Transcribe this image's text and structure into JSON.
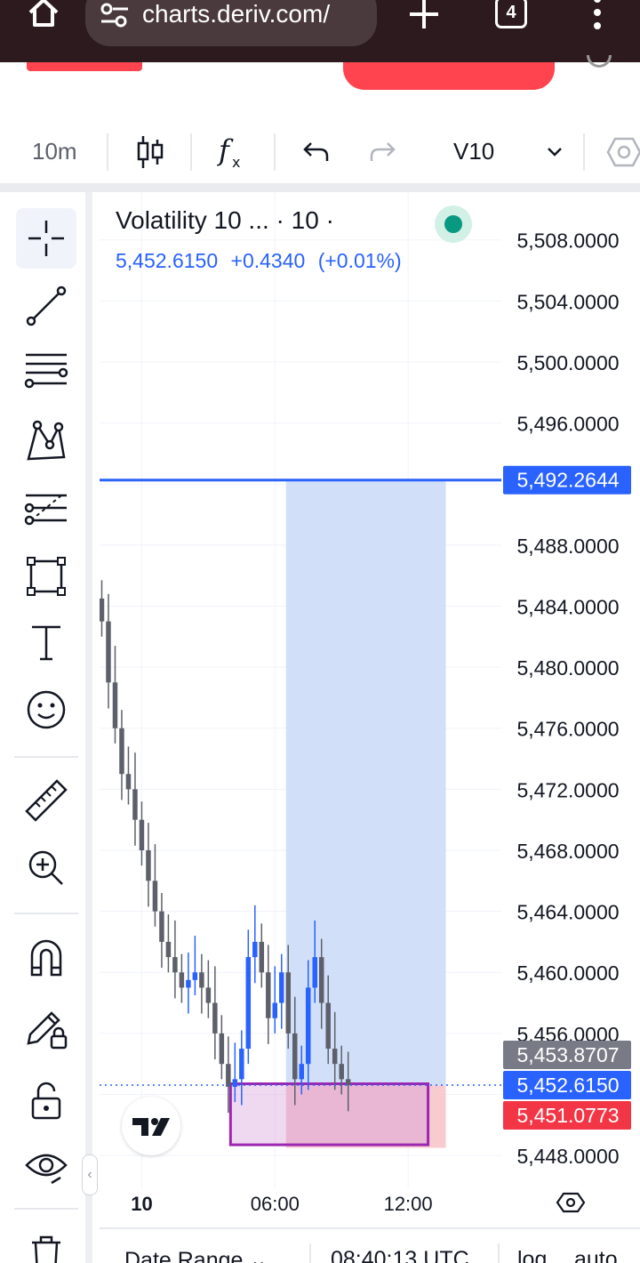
{
  "browser": {
    "url": "charts.deriv.com/",
    "tab_count": "4"
  },
  "toolbar": {
    "interval": "10m",
    "symbol_short": "V10"
  },
  "legend": {
    "title": "Volatility 10 ... · 10 ·",
    "last": "5,452.6150",
    "change": "+0.4340",
    "change_pct": "(+0.01%)"
  },
  "colors": {
    "accent": "#2962ff",
    "up": "#2962ff",
    "down": "#5d606b",
    "profit_zone": "#c9dbf7",
    "loss_zone": "#f7c5cc",
    "highlight_box": "#9c27b0",
    "stop_label": "#f23645",
    "target_label": "#2962ff",
    "entry_label": "#787b86",
    "live_dot": "#089981"
  },
  "bottom": {
    "date_range": "Date Range ⌄",
    "utc_time": "08:40:13 UTC",
    "scale_log": "log",
    "scale_auto": "auto"
  },
  "chart_data": {
    "type": "candlestick",
    "ylim": [
      5446.2,
      5510.2
    ],
    "y_ticks": [
      "5,508.0000",
      "5,504.0000",
      "5,500.0000",
      "5,496.0000",
      "5,488.0000",
      "5,484.0000",
      "5,480.0000",
      "5,476.0000",
      "5,472.0000",
      "5,468.0000",
      "5,464.0000",
      "5,460.0000",
      "5,456.0000",
      "5,448.0000"
    ],
    "y_tick_values": [
      5508,
      5504,
      5500,
      5496,
      5488,
      5484,
      5480,
      5476,
      5472,
      5468,
      5464,
      5460,
      5456,
      5448
    ],
    "x_ticks": [
      "10",
      "06:00",
      "12:00"
    ],
    "x_tick_hours": [
      0,
      6,
      12
    ],
    "xlim_hours": [
      -1.9,
      16.2
    ],
    "horizontal_line": {
      "value": 5492.2644,
      "label": "5,492.2644"
    },
    "price_labels": [
      {
        "kind": "target",
        "value": 5453.8707,
        "label": "5,453.8707"
      },
      {
        "kind": "last",
        "value": 5452.615,
        "label": "5,452.6150"
      },
      {
        "kind": "stop",
        "value": 5451.0773,
        "label": "5,451.0773"
      }
    ],
    "position_tool": {
      "start_hour": 6.5,
      "end_hour": 13.7,
      "target": 5492.2644,
      "entry": 5452.6,
      "stop": 5448.5
    },
    "highlight_box": {
      "start_hour": 4.0,
      "end_hour": 12.9,
      "top": 5452.7,
      "bottom": 5448.7
    },
    "candles": [
      {
        "t": -1.8,
        "c": 5483.0
      },
      {
        "t": -1.5,
        "c": 5479.0
      },
      {
        "t": -1.2,
        "c": 5476.0
      },
      {
        "t": -0.9,
        "c": 5473.0
      },
      {
        "t": -0.6,
        "c": 5472.0
      },
      {
        "t": -0.3,
        "c": 5470.0
      },
      {
        "t": 0.0,
        "c": 5468.0
      },
      {
        "t": 0.3,
        "c": 5466.0
      },
      {
        "t": 0.6,
        "c": 5464.0
      },
      {
        "t": 0.9,
        "c": 5462.0
      },
      {
        "t": 1.2,
        "c": 5461.0
      },
      {
        "t": 1.5,
        "c": 5460.0
      },
      {
        "t": 1.8,
        "c": 5459.0
      },
      {
        "t": 2.1,
        "c": 5459.5
      },
      {
        "t": 2.4,
        "c": 5460.0
      },
      {
        "t": 2.7,
        "c": 5459.0
      },
      {
        "t": 3.0,
        "c": 5458.0
      },
      {
        "t": 3.3,
        "c": 5456.0
      },
      {
        "t": 3.6,
        "c": 5454.0
      },
      {
        "t": 3.9,
        "c": 5452.5
      },
      {
        "t": 4.2,
        "c": 5453.0
      },
      {
        "t": 4.5,
        "c": 5455.0
      },
      {
        "t": 4.8,
        "c": 5461.0
      },
      {
        "t": 5.1,
        "c": 5462.0
      },
      {
        "t": 5.4,
        "c": 5460.0
      },
      {
        "t": 5.7,
        "c": 5457.0
      },
      {
        "t": 6.0,
        "c": 5458.0
      },
      {
        "t": 6.3,
        "c": 5460.0
      },
      {
        "t": 6.6,
        "c": 5456.0
      },
      {
        "t": 6.9,
        "c": 5453.0
      },
      {
        "t": 7.2,
        "c": 5454.0
      },
      {
        "t": 7.5,
        "c": 5459.0
      },
      {
        "t": 7.8,
        "c": 5461.0
      },
      {
        "t": 8.1,
        "c": 5458.0
      },
      {
        "t": 8.4,
        "c": 5455.0
      },
      {
        "t": 8.7,
        "c": 5454.0
      },
      {
        "t": 9.0,
        "c": 5453.0
      },
      {
        "t": 9.3,
        "c": 5452.6
      }
    ]
  }
}
